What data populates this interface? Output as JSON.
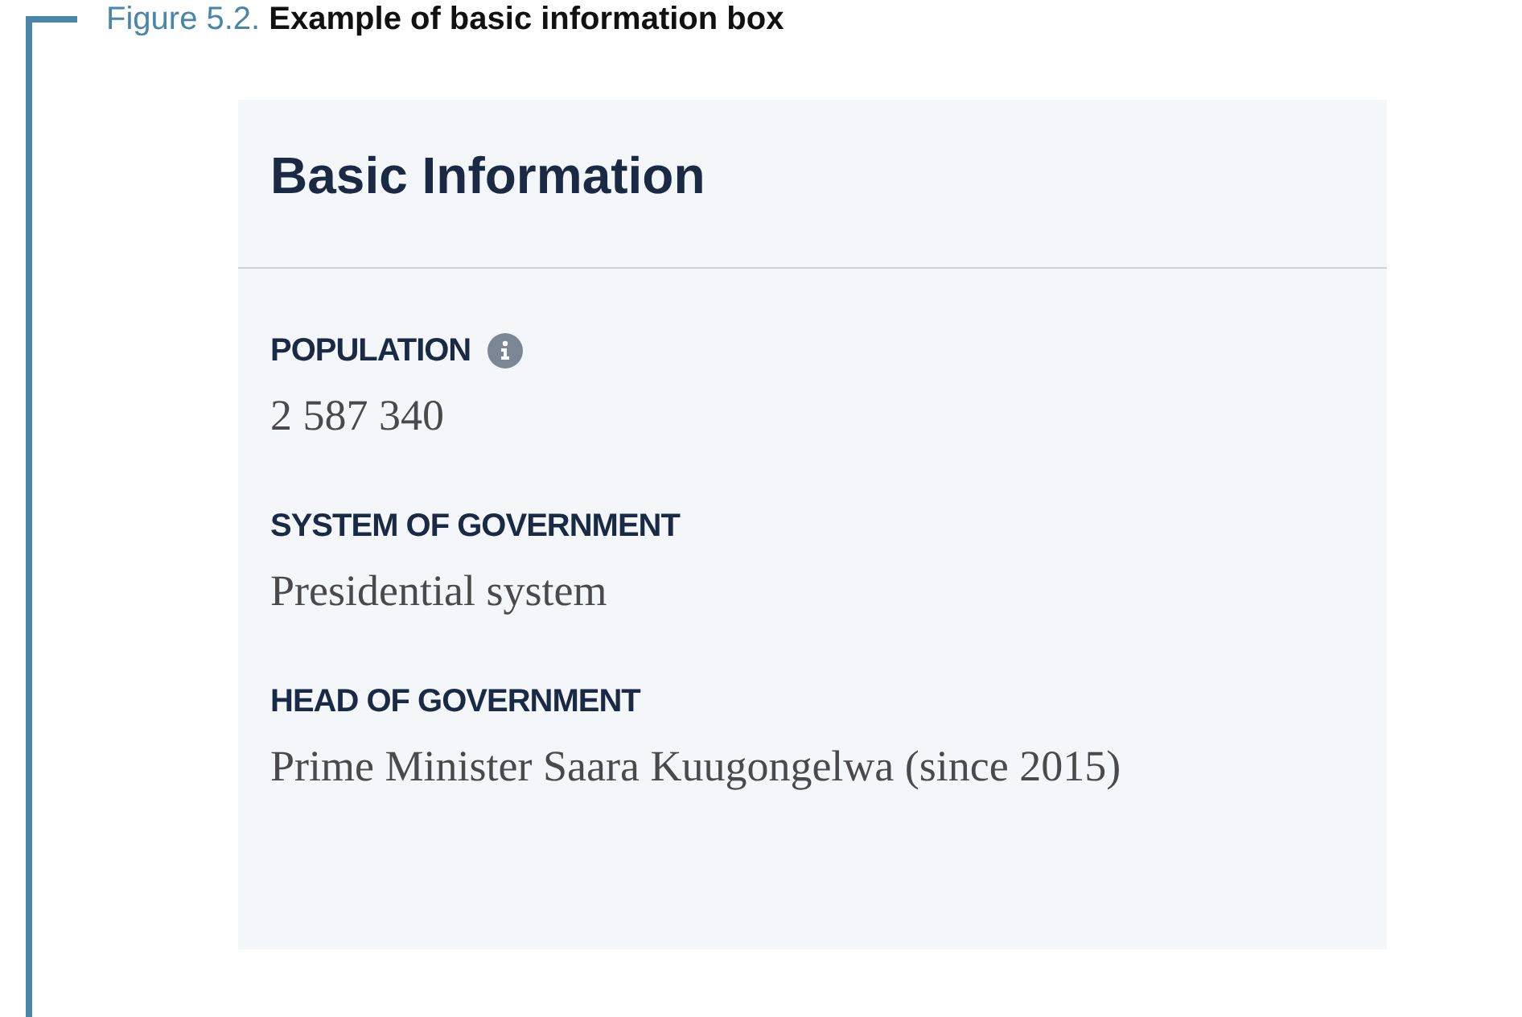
{
  "caption": "Figure 5.2. **Example of basic information box**",
  "box": {
    "title": "Basic Information",
    "fields": [
      {
        "label": "POPULATION",
        "info_icon": true,
        "value": "2 587 340"
      },
      {
        "label": "SYSTEM OF GOVERNMENT",
        "info_icon": false,
        "value": "Presidential system"
      },
      {
        "label": "HEAD OF GOVERNMENT",
        "info_icon": false,
        "value": "Prime Minister Saara Kuugongelwa (since 2015)"
      }
    ]
  }
}
